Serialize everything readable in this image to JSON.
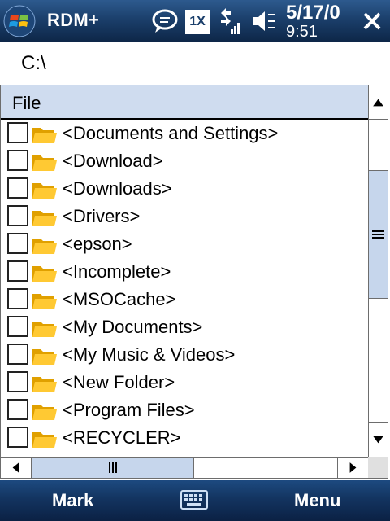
{
  "titlebar": {
    "app_title": "RDM+",
    "date": "5/17/0",
    "time": "9:51",
    "network_badge": "1X",
    "icons": [
      "windows-start-icon",
      "message-bubble-icon",
      "1x-network-icon",
      "signal-data-icon",
      "speaker-volume-icon",
      "close-icon"
    ]
  },
  "path": {
    "current": "C:\\"
  },
  "list": {
    "header": "File",
    "items": [
      {
        "label": "<Documents and Settings>"
      },
      {
        "label": "<Download>"
      },
      {
        "label": "<Downloads>"
      },
      {
        "label": "<Drivers>"
      },
      {
        "label": "<epson>"
      },
      {
        "label": "<Incomplete>"
      },
      {
        "label": "<MSOCache>"
      },
      {
        "label": "<My Documents>"
      },
      {
        "label": "<My Music & Videos>"
      },
      {
        "label": "<New Folder>"
      },
      {
        "label": "<Program Files>"
      },
      {
        "label": "<RECYCLER>"
      }
    ]
  },
  "softkeys": {
    "left": "Mark",
    "right": "Menu",
    "center_icon": "keyboard-icon"
  },
  "colors": {
    "titlebar": "#1b3f6b",
    "header_bg": "#cfdcef",
    "scroll_thumb": "#c6d6ec",
    "folder": "#f5b800"
  }
}
